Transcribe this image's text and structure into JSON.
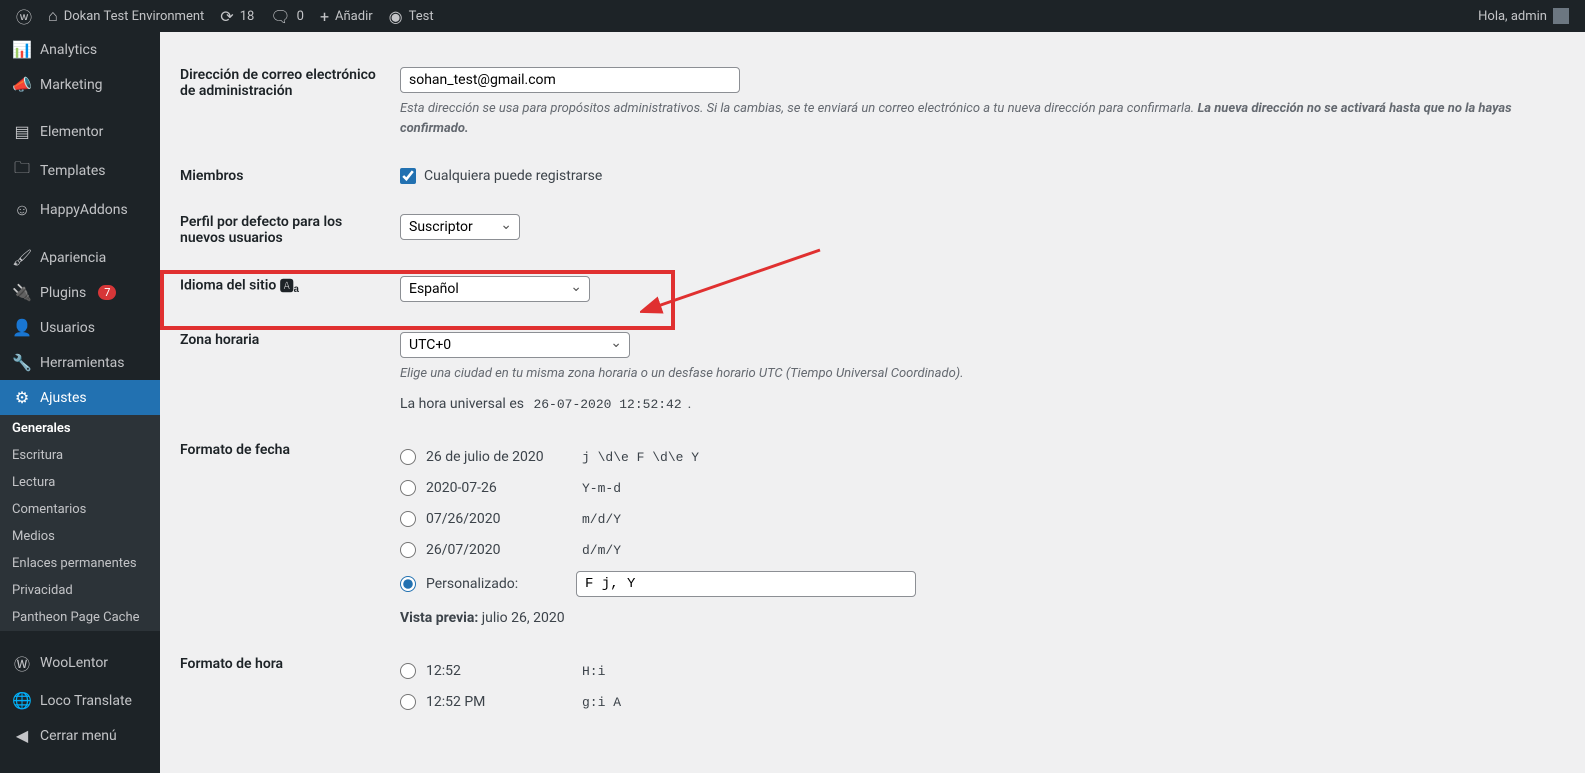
{
  "adminbar": {
    "site_name": "Dokan Test Environment",
    "updates": "18",
    "comments": "0",
    "add_new": "Añadir",
    "test": "Test",
    "greeting": "Hola, admin"
  },
  "sidebar": {
    "items": [
      {
        "icon": "chart",
        "label": "Analytics"
      },
      {
        "icon": "megaphone",
        "label": "Marketing"
      },
      {
        "icon": "elementor",
        "label": "Elementor"
      },
      {
        "icon": "folder",
        "label": "Templates"
      },
      {
        "icon": "happy",
        "label": "HappyAddons"
      },
      {
        "icon": "brush",
        "label": "Apariencia"
      },
      {
        "icon": "plugin",
        "label": "Plugins",
        "badge": "7"
      },
      {
        "icon": "users",
        "label": "Usuarios"
      },
      {
        "icon": "wrench",
        "label": "Herramientas"
      },
      {
        "icon": "settings",
        "label": "Ajustes"
      }
    ],
    "sub_items": [
      "Generales",
      "Escritura",
      "Lectura",
      "Comentarios",
      "Medios",
      "Enlaces permanentes",
      "Privacidad",
      "Pantheon Page Cache"
    ],
    "tail_items": [
      {
        "icon": "woo",
        "label": "WooLentor"
      },
      {
        "icon": "loco",
        "label": "Loco Translate"
      },
      {
        "icon": "collapse",
        "label": "Cerrar menú"
      }
    ]
  },
  "form": {
    "email_label": "Dirección de correo electrónico de administración",
    "email_value": "sohan_test@gmail.com",
    "email_desc1": "Esta dirección se usa para propósitos administrativos. Si la cambias, se te enviará un correo electrónico a tu nueva dirección para confirmarla. ",
    "email_desc2": "La nueva dirección no se activará hasta que no la hayas confirmado.",
    "members_label": "Miembros",
    "members_check": "Cualquiera puede registrarse",
    "role_label": "Perfil por defecto para los nuevos usuarios",
    "role_value": "Suscriptor",
    "lang_label": "Idioma del sitio",
    "lang_value": "Español",
    "tz_label": "Zona horaria",
    "tz_value": "UTC+0",
    "tz_desc": "Elige una ciudad en tu misma zona horaria o un desfase horario UTC (Tiempo Universal Coordinado).",
    "utc_text": "La hora universal es ",
    "utc_time": "26-07-2020 12:52:42",
    "utc_period": ".",
    "date_label": "Formato de fecha",
    "date_formats": [
      {
        "label": "26 de julio de 2020",
        "code": "j \\d\\e F \\d\\e Y"
      },
      {
        "label": "2020-07-26",
        "code": "Y-m-d"
      },
      {
        "label": "07/26/2020",
        "code": "m/d/Y"
      },
      {
        "label": "26/07/2020",
        "code": "d/m/Y"
      }
    ],
    "date_custom_label": "Personalizado:",
    "date_custom_value": "F j, Y",
    "preview_label": "Vista previa:",
    "preview_value": " julio 26, 2020",
    "time_label": "Formato de hora",
    "time_formats": [
      {
        "label": "12:52",
        "code": "H:i"
      },
      {
        "label": "12:52 PM",
        "code": "g:i A"
      }
    ]
  }
}
